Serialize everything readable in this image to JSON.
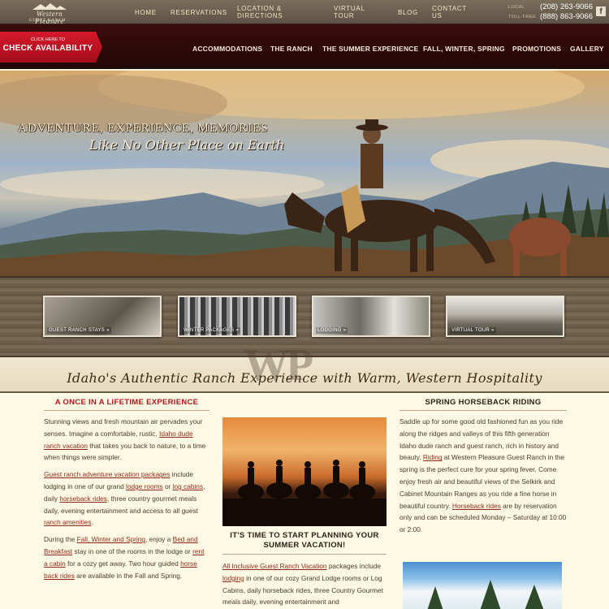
{
  "site": {
    "logo_text": "Western Pleasure",
    "logo_sub": "GUEST RANCH · IDAHO"
  },
  "topnav": [
    {
      "label": "HOME"
    },
    {
      "label": "RESERVATIONS"
    },
    {
      "label": "LOCATION & DIRECTIONS"
    },
    {
      "label": "VIRTUAL TOUR"
    },
    {
      "label": "BLOG"
    },
    {
      "label": "CONTACT US"
    }
  ],
  "phones": {
    "local_label": "LOCAL",
    "local": "(208) 263-9066",
    "tollfree_label": "TOLL FREE",
    "tollfree": "(888) 863-9066"
  },
  "cta": {
    "small": "CLICK HERE TO",
    "big": "CHECK AVAILABILITY"
  },
  "mainnav": [
    {
      "label": "ACCOMMODATIONS"
    },
    {
      "label": "THE RANCH"
    },
    {
      "label": "THE SUMMER EXPERIENCE"
    },
    {
      "label": "FALL, WINTER, SPRING"
    },
    {
      "label": "PROMOTIONS"
    },
    {
      "label": "GALLERY"
    }
  ],
  "hero": {
    "tagline": "ADVENTURE, EXPERIENCE, MEMORIES",
    "script": "Like No Other Place on Earth"
  },
  "thumbs": [
    {
      "label": "GUEST RANCH STAYS »"
    },
    {
      "label": "WINTER PACKAGES »"
    },
    {
      "label": "LODGING »"
    },
    {
      "label": "VIRTUAL TOUR »"
    }
  ],
  "slogan": "Idaho's Authentic Ranch Experience with Warm, Western Hospitality",
  "watermark": "WP",
  "col1": {
    "heading": "A ONCE IN A LIFETIME EXPERIENCE",
    "p1a": "Stunning views and fresh mountain air pervades your senses. Imagine a comfortable, rustic, ",
    "p1link": "Idaho dude ranch vacation",
    "p1b": " that takes you back to nature, to a time when things were simpler.",
    "p2link": "Guest ranch adventure vacation packages",
    "p2a": " include lodging in one of our grand ",
    "p2link2": "lodge rooms",
    "p2b": " or ",
    "p2link3": "log cabins",
    "p2c": ", daily ",
    "p2link4": "horseback rides",
    "p2d": ", three country gourmet meals daily, evening entertainment and access to all guest ",
    "p2link5": "ranch amenities",
    "p2e": ".",
    "p3a": "During the ",
    "p3link": "Fall, Winter and Spring",
    "p3b": ", enjoy a ",
    "p3link2": "Bed and Breakfast",
    "p3c": " stay in one of the rooms in the lodge or ",
    "p3link3": "rent a cabin",
    "p3d": " for a cozy get away.  Two hour guided ",
    "p3link4": "horse back rides",
    "p3e": " are available in the Fall and Spring."
  },
  "col2": {
    "heading": "IT'S TIME TO START PLANNING YOUR SUMMER VACATION!",
    "p1link": "All Inclusive Guest Ranch Vacation",
    "p1a": " packages include ",
    "p1link2": "lodging",
    "p1b": " in one of our cozy Grand Lodge rooms or Log Cabins, daily horseback rides, three Country Gourmet meals daily, evening entertainment and"
  },
  "col3": {
    "heading": "SPRING HORSEBACK RIDING",
    "p1a": "Saddle up for some good old fashioned fun as you ride along the ridges and valleys of this fifth generation Idaho dude ranch and guest ranch, rich in history and beauty. ",
    "p1link": "Riding",
    "p1b": " at Western Pleasure Guest Ranch in the spring is the perfect cure for your spring fever. Come enjoy fresh air and beautiful views of the Selkirk and Cabinet Mountain Ranges as you ride a fine horse in beautiful country. ",
    "p1link2": "Horseback rides",
    "p1c": " are by reservation only and can be scheduled Monday – Saturday at 10:00 or 2:00."
  },
  "colors": {
    "accent": "#b0161f",
    "nav_bg": "#2d0909",
    "link": "#8f2b1a",
    "cream": "#fdf9e4"
  }
}
